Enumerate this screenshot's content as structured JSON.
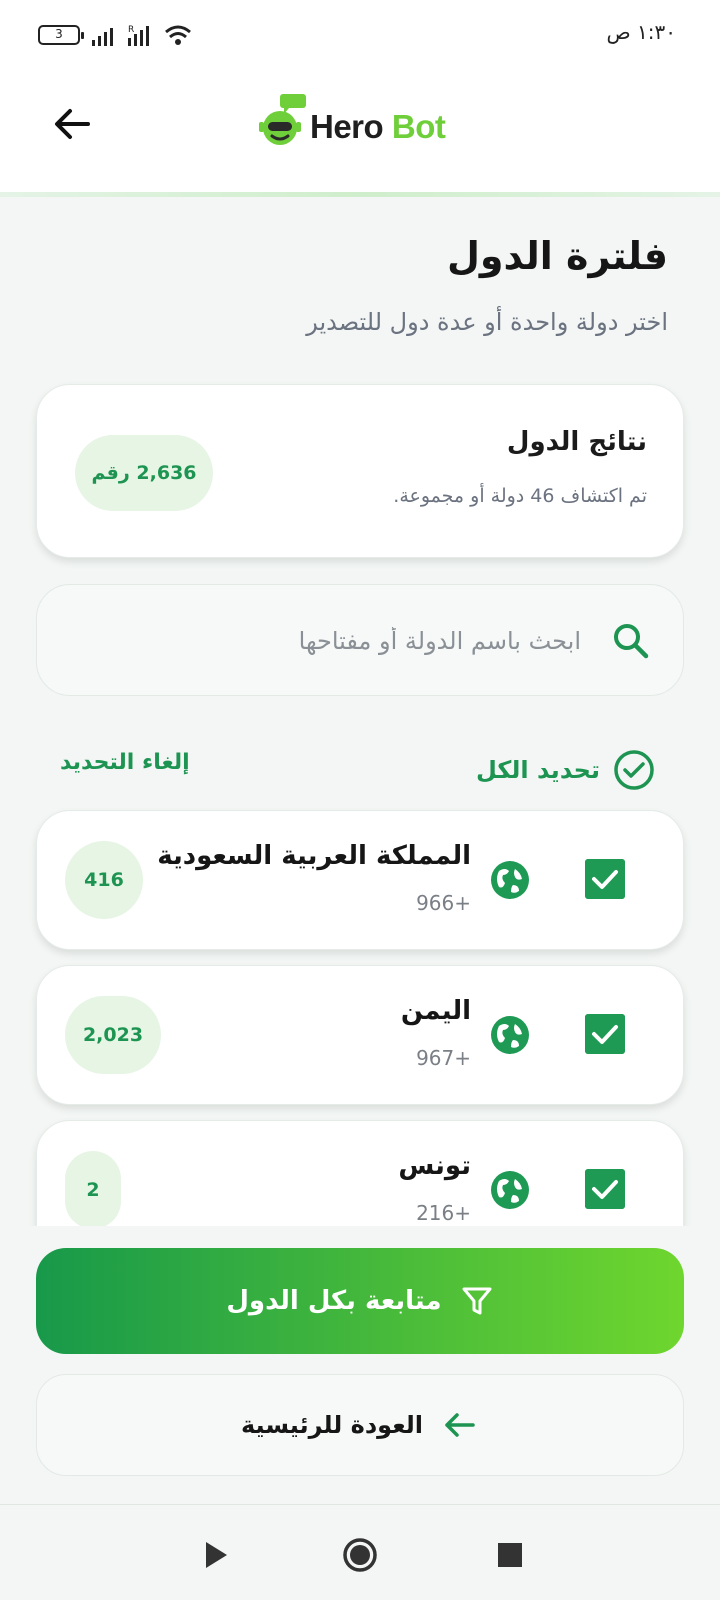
{
  "status_bar": {
    "time": "١:٣٠ ص",
    "battery": "3"
  },
  "header": {
    "logo_word1": "Hero",
    "logo_word2": "Bot"
  },
  "page": {
    "title": "فلترة الدول",
    "subtitle": "اختر دولة واحدة أو عدة دول للتصدير"
  },
  "results": {
    "title": "نتائج الدول",
    "description": "تم اكتشاف 46 دولة أو مجموعة.",
    "count": "2,636 رقم"
  },
  "search": {
    "placeholder": "ابحث باسم الدولة أو مفتاحها"
  },
  "selection": {
    "select_all": "تحديد الكل",
    "deselect": "إلغاء التحديد"
  },
  "countries": [
    {
      "name": "المملكة العربية السعودية",
      "code": "966+",
      "count": "416",
      "checked": true
    },
    {
      "name": "اليمن",
      "code": "967+",
      "count": "2,023",
      "checked": true
    },
    {
      "name": "تونس",
      "code": "216+",
      "count": "2",
      "checked": true
    }
  ],
  "buttons": {
    "continue": "متابعة بكل الدول",
    "home": "العودة للرئيسية"
  },
  "colors": {
    "accent": "#1d9451",
    "gradient_start": "#18994a",
    "gradient_end": "#6fd62e",
    "pill_bg": "#e6f5e4"
  },
  "icons": [
    "back-arrow-icon",
    "search-icon",
    "check-circle-icon",
    "globe-icon",
    "checkbox-icon",
    "filter-icon",
    "arrow-left-icon",
    "play-icon",
    "circle-icon",
    "stop-icon"
  ]
}
